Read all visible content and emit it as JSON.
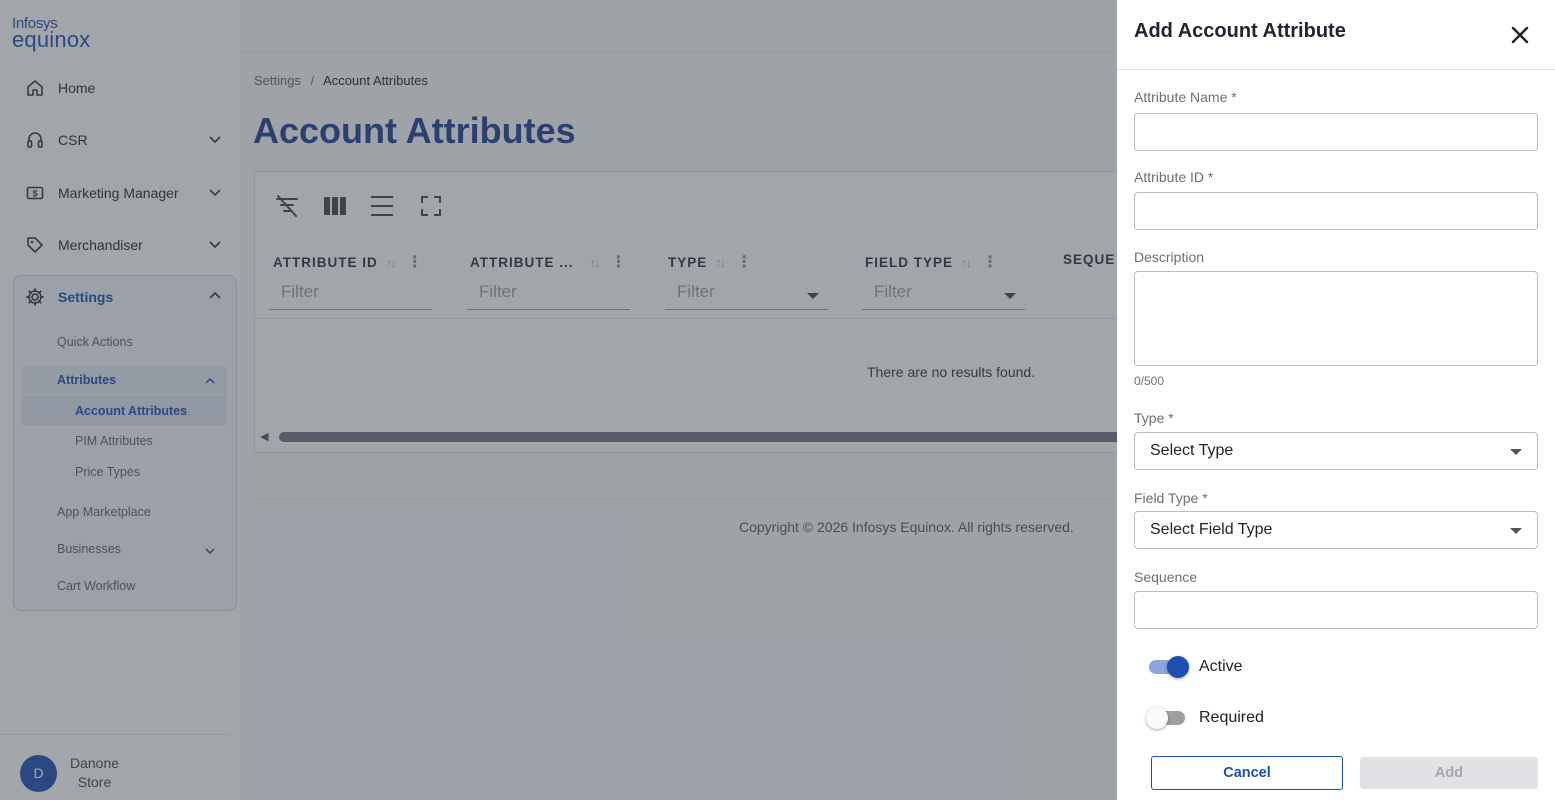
{
  "logo": {
    "line1": "Infosys",
    "line2": "equinox"
  },
  "sidebar": {
    "items": [
      {
        "label": "Home",
        "icon": "home-icon"
      },
      {
        "label": "CSR",
        "icon": "headset-icon"
      },
      {
        "label": "Marketing Manager",
        "icon": "dollar-icon"
      },
      {
        "label": "Merchandiser",
        "icon": "tag-icon"
      },
      {
        "label": "Settings",
        "icon": "gear-icon"
      }
    ],
    "settings_children": {
      "quick_actions": "Quick Actions",
      "attributes": "Attributes",
      "account_attributes": "Account Attributes",
      "pim_attributes": "PIM Attributes",
      "price_types": "Price Types",
      "app_marketplace": "App Marketplace",
      "businesses": "Businesses",
      "cart_workflow": "Cart Workflow"
    }
  },
  "user": {
    "initial": "D",
    "name_line1": "Danone",
    "name_line2": "Store"
  },
  "breadcrumb": {
    "parent": "Settings",
    "separator": "/",
    "current": "Account Attributes"
  },
  "page_title": "Account Attributes",
  "grid": {
    "columns": [
      {
        "title": "ATTRIBUTE ID",
        "filter_placeholder": "Filter"
      },
      {
        "title": "ATTRIBUTE ...",
        "filter_placeholder": "Filter"
      },
      {
        "title": "TYPE",
        "filter_placeholder": "Filter"
      },
      {
        "title": "FIELD TYPE",
        "filter_placeholder": "Filter"
      },
      {
        "title": "SEQUE"
      }
    ],
    "empty_message": "There are no results found."
  },
  "footer": {
    "copyright": "Copyright © 2026 Infosys Equinox. All rights reserved."
  },
  "drawer": {
    "title": "Add Account Attribute",
    "fields": {
      "attribute_name": {
        "label": "Attribute Name *",
        "value": ""
      },
      "attribute_id": {
        "label": "Attribute ID *",
        "value": ""
      },
      "description": {
        "label": "Description",
        "value": "",
        "counter": "0/500"
      },
      "type": {
        "label": "Type *",
        "value": "Select Type"
      },
      "field_type": {
        "label": "Field Type *",
        "value": "Select Field Type"
      },
      "sequence": {
        "label": "Sequence",
        "value": ""
      }
    },
    "toggles": {
      "active": {
        "label": "Active",
        "on": true
      },
      "required": {
        "label": "Required",
        "on": false
      }
    },
    "buttons": {
      "cancel": "Cancel",
      "add": "Add"
    }
  },
  "colors": {
    "brand": "#1c4fae",
    "title": "#1c3f8e",
    "overlay": "rgba(60,66,78,0.48)",
    "disabled_button": "#e1e2e5"
  }
}
